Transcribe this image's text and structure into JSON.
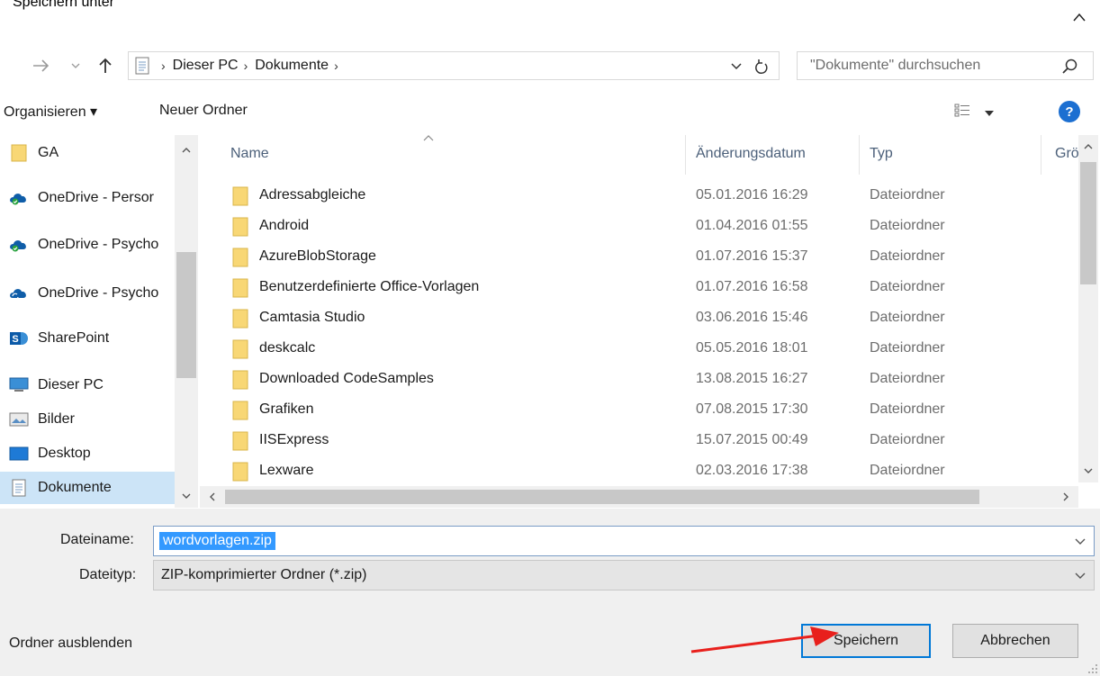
{
  "window": {
    "title": "Speichern unter"
  },
  "address": {
    "crumbs": [
      "Dieser PC",
      "Dokumente"
    ],
    "search_placeholder": "\"Dokumente\" durchsuchen"
  },
  "toolbar": {
    "organize_label": "Organisieren ▾",
    "new_folder_label": "Neuer Ordner",
    "help_label": "?"
  },
  "navpane": {
    "items": [
      {
        "label": "GA",
        "icon": "folder-icon"
      },
      {
        "label": "OneDrive - Persor",
        "icon": "onedrive-icon"
      },
      {
        "label": "OneDrive - Psycho",
        "icon": "onedrive-icon"
      },
      {
        "label": "OneDrive - Psycho",
        "icon": "onedrive-sync-icon"
      },
      {
        "label": "SharePoint",
        "icon": "sharepoint-icon"
      },
      {
        "label": "Dieser PC",
        "icon": "computer-icon"
      },
      {
        "label": "Bilder",
        "icon": "pictures-icon"
      },
      {
        "label": "Desktop",
        "icon": "desktop-icon"
      },
      {
        "label": "Dokumente",
        "icon": "documents-icon",
        "selected": true
      }
    ]
  },
  "filelist": {
    "columns": {
      "name": "Name",
      "date": "Änderungsdatum",
      "type": "Typ",
      "size": "Größ"
    },
    "rows": [
      {
        "name": "Adressabgleiche",
        "date": "05.01.2016 16:29",
        "type": "Dateiordner"
      },
      {
        "name": "Android",
        "date": "01.04.2016 01:55",
        "type": "Dateiordner"
      },
      {
        "name": "AzureBlobStorage",
        "date": "01.07.2016 15:37",
        "type": "Dateiordner"
      },
      {
        "name": "Benutzerdefinierte Office-Vorlagen",
        "date": "01.07.2016 16:58",
        "type": "Dateiordner"
      },
      {
        "name": "Camtasia Studio",
        "date": "03.06.2016 15:46",
        "type": "Dateiordner"
      },
      {
        "name": "deskcalc",
        "date": "05.05.2016 18:01",
        "type": "Dateiordner"
      },
      {
        "name": "Downloaded CodeSamples",
        "date": "13.08.2015 16:27",
        "type": "Dateiordner"
      },
      {
        "name": "Grafiken",
        "date": "07.08.2015 17:30",
        "type": "Dateiordner"
      },
      {
        "name": "IISExpress",
        "date": "15.07.2015 00:49",
        "type": "Dateiordner"
      },
      {
        "name": "Lexware",
        "date": "02.03.2016 17:38",
        "type": "Dateiordner"
      }
    ]
  },
  "form": {
    "filename_label": "Dateiname:",
    "filename_value": "wordvorlagen.zip",
    "filetype_label": "Dateityp:",
    "filetype_value": "ZIP-komprimierter Ordner (*.zip)"
  },
  "footer": {
    "hide_folders_label": "Ordner ausblenden",
    "save_label": "Speichern",
    "cancel_label": "Abbrechen"
  },
  "colors": {
    "selection": "#cce4f7",
    "accent": "#0078d7",
    "folder": "#f8d775",
    "annotation_arrow": "#e8201c"
  }
}
